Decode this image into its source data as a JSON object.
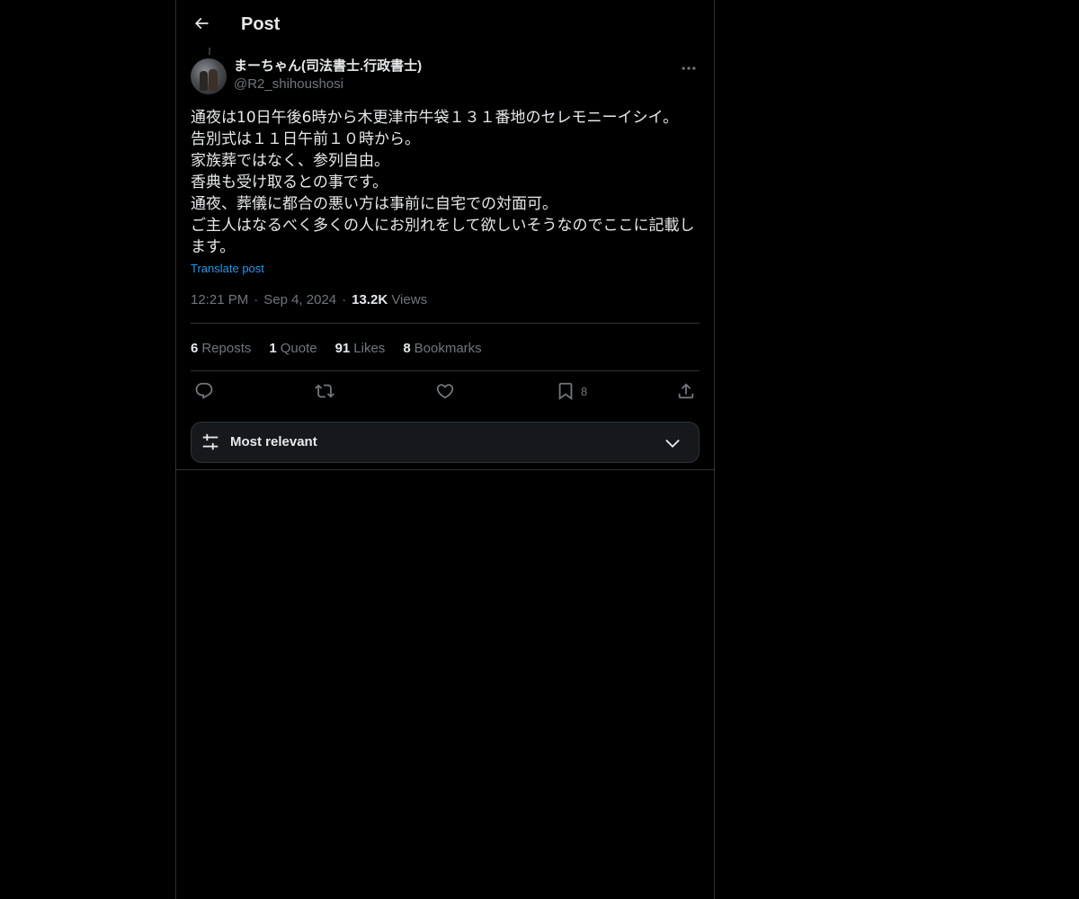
{
  "header": {
    "title": "Post",
    "back_icon": "arrow-left-icon"
  },
  "post": {
    "author": {
      "display_name": "まーちゃん(司法書士.行政書士)",
      "handle": "@R2_shihoushosi"
    },
    "lines": [
      "通夜は10日午後6時から木更津市牛袋１３１番地のセレモニーイシイ。",
      "告別式は１１日午前１０時から。",
      "家族葬ではなく、参列自由。",
      "香典も受け取るとの事です。",
      "通夜、葬儀に都合の悪い方は事前に自宅での対面可。",
      "ご主人はなるべく多くの人にお別れをして欲しいそうなのでここに記載します。"
    ],
    "translate_label": "Translate post",
    "time": "12:21 PM",
    "date": "Sep 4, 2024",
    "views_count": "13.2K",
    "views_label": "Views",
    "stats": {
      "reposts_count": "6",
      "reposts_label": "Reposts",
      "quotes_count": "1",
      "quotes_label": "Quote",
      "likes_count": "91",
      "likes_label": "Likes",
      "bookmarks_count": "8",
      "bookmarks_label": "Bookmarks"
    },
    "actions": {
      "bookmark_count": "8"
    }
  },
  "sort": {
    "label": "Most relevant"
  },
  "colors": {
    "background": "#000000",
    "text": "#e7e9ea",
    "muted": "#71767b",
    "link": "#1d9bf0",
    "border": "#2f3336"
  }
}
